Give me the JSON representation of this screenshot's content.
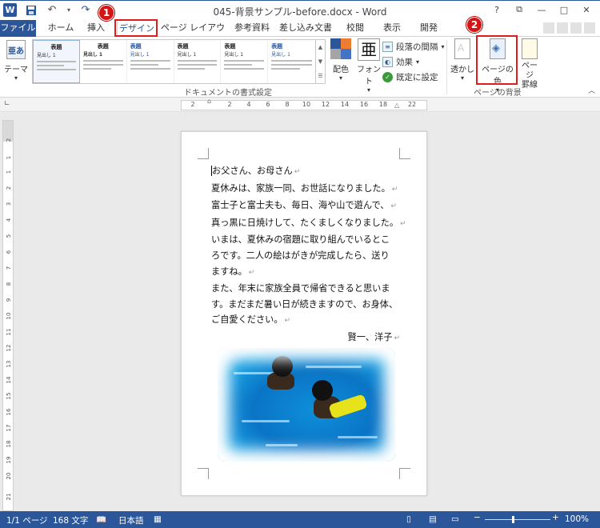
{
  "window": {
    "title": "045-背景サンプル-before.docx - Word",
    "controls": [
      "?",
      "⧉",
      "—",
      "□",
      "✕"
    ]
  },
  "tabs": [
    "ファイル",
    "ホーム",
    "挿入",
    "デザイン",
    "ページ レイアウト",
    "参考資料",
    "差し込み文書",
    "校閲",
    "表示",
    "開発"
  ],
  "badges": [
    "1",
    "2"
  ],
  "ribbon": {
    "theme_label": "テーマ",
    "theme_icon_text": "亜あ",
    "gallery": [
      {
        "heading": "表題",
        "sub": "見出し 1"
      },
      {
        "heading": "表題",
        "sub": "見出し 1"
      },
      {
        "heading": "表題",
        "sub": "見出し 1"
      },
      {
        "heading": "表題",
        "sub": "見出し 1"
      },
      {
        "heading": "表題",
        "sub": "見出し 1"
      },
      {
        "heading": "表題",
        "sub": "見出し 1"
      }
    ],
    "group_doc_format": "ドキュメントの書式設定",
    "colors_label": "配色",
    "fonts_label": "フォント",
    "fonts_icon_text": "亜",
    "paragraph_spacing": "段落の間隔",
    "effects": "効果",
    "set_default": "既定に設定",
    "watermark_label": "透かし",
    "page_color_label": "ページの色",
    "page_borders_label_1": "ページ",
    "page_borders_label_2": "罫線",
    "group_page_bg": "ページの背景"
  },
  "ruler": {
    "ticks": [
      "2",
      "2",
      "4",
      "6",
      "8",
      "10",
      "12",
      "14",
      "16",
      "18",
      "22"
    ],
    "vticks": [
      "2",
      "1",
      "1",
      "2",
      "3",
      "4",
      "5",
      "6",
      "7",
      "8",
      "9",
      "10",
      "11",
      "12",
      "13",
      "14",
      "15",
      "16",
      "17",
      "18",
      "19",
      "20",
      "21"
    ]
  },
  "document": {
    "lines": [
      "お父さん、お母さん",
      "夏休みは、家族一同、お世話になりました。",
      "富士子と富士夫も、毎日、海や山で遊んで、",
      "真っ黒に日焼けして、たくましくなりました。",
      "いまは、夏休みの宿題に取り組んでいるとこ",
      "ろです。二人の絵はがきが完成したら、送り",
      "ますね。",
      "また、年末に家族全員で帰省できると思いま",
      "す。まだまだ暑い日が続きますので、お身体、",
      "ご自愛ください。"
    ],
    "signature": "賢一、洋子",
    "para_mark": "↵"
  },
  "status": {
    "page": "1/1 ページ",
    "words": "168 文字",
    "language": "日本語",
    "zoom": "100%"
  },
  "colors": {
    "accent": "#2b579a",
    "highlight": "#e21b1b"
  }
}
